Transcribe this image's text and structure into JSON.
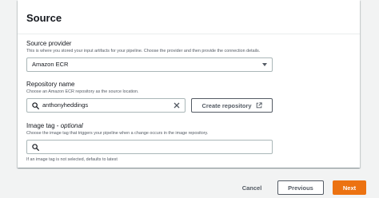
{
  "section": {
    "title": "Source"
  },
  "source_provider": {
    "label": "Source provider",
    "description": "This is where you stored your input artifacts for your pipeline. Choose the provider and then provide the connection details.",
    "selected": "Amazon ECR"
  },
  "repository": {
    "label": "Repository name",
    "description": "Choose an Amazon ECR repository as the source location.",
    "value": "anthonyheddings",
    "create_button": "Create repository"
  },
  "image_tag": {
    "label": "Image tag - ",
    "label_optional": "optional",
    "description": "Choose the image tag that triggers your pipeline when a change occurs in the image repository.",
    "value": "",
    "hint": "If an image tag is not selected, defaults to latest"
  },
  "footer": {
    "cancel": "Cancel",
    "previous": "Previous",
    "next": "Next"
  },
  "colors": {
    "primary": "#ec7211",
    "border": "#aab7b8",
    "secondary_text": "#545b64"
  },
  "icons": [
    "search-icon",
    "clear-icon",
    "external-link-icon",
    "caret-down-icon"
  ]
}
